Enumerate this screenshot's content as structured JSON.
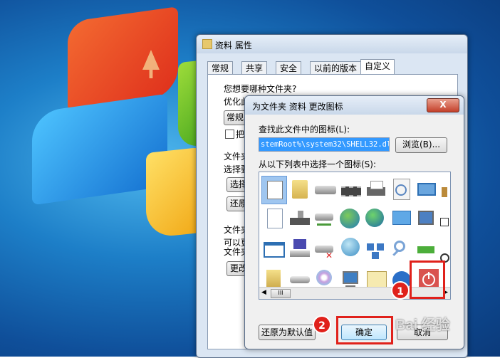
{
  "back_window": {
    "title": "资料 属性",
    "tabs": [
      "常规",
      "共享",
      "安全",
      "以前的版本",
      "自定义"
    ],
    "group1_question": "您想要哪种文件夹?",
    "group1_optimize": "优化此",
    "group1_select": "常规",
    "group1_checkbox": "把",
    "group2_title": "文件夹",
    "group2_text": "选择要",
    "group2_button1": "选择",
    "group2_button2": "还原",
    "group3_title": "文件夹",
    "group3_text1": "可以更",
    "group3_text2": "文件夹",
    "group3_button": "更改"
  },
  "dialog": {
    "title": "为文件夹 资料 更改图标",
    "close": "X",
    "find_label": "查找此文件中的图标(L):",
    "path_value": "stemRoot%\\system32\\SHELL32.dll",
    "browse_button": "浏览(B)...",
    "list_label": "从以下列表中选择一个图标(S):",
    "restore_button": "还原为默认值",
    "ok_button": "确定",
    "cancel_button": "取消",
    "scroll_thumb": "III"
  },
  "annotations": {
    "badge1": "1",
    "badge2": "2"
  },
  "watermark": "Bai 经验",
  "colors": {
    "highlight": "#e0211b",
    "selected_icon_bg": "#d9534f"
  }
}
